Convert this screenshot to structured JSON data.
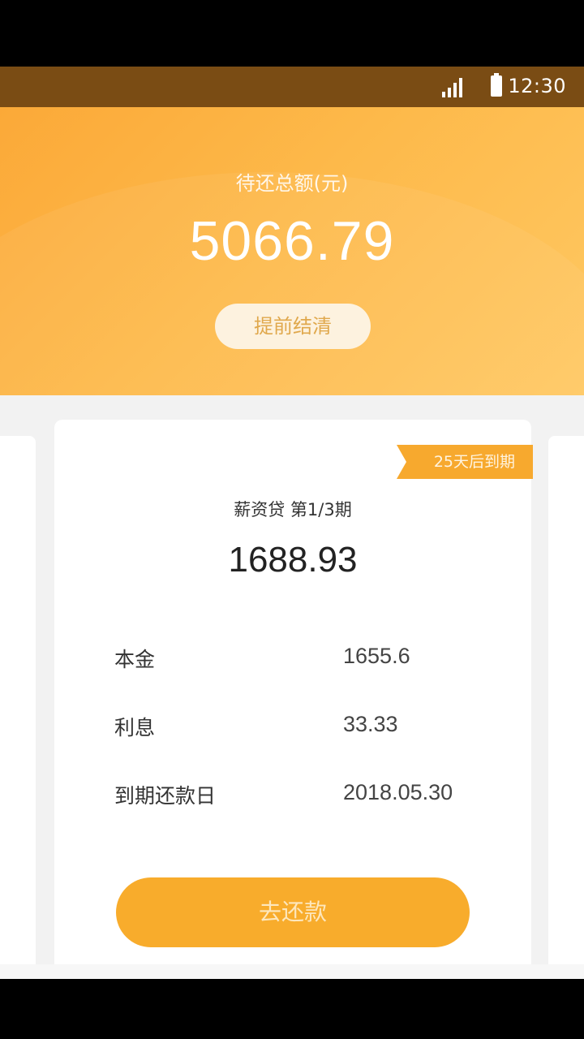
{
  "status_bar": {
    "time": "12:30"
  },
  "header": {
    "total_label": "待还总额(元)",
    "total_amount": "5066.79",
    "settle_button": "提前结清"
  },
  "card": {
    "due_tag": "25天后到期",
    "loan_title": "薪资贷 第1/3期",
    "amount": "1688.93",
    "details": [
      {
        "label": "本金",
        "value": "1655.6"
      },
      {
        "label": "利息",
        "value": "33.33"
      },
      {
        "label": "到期还款日",
        "value": "2018.05.30"
      }
    ],
    "pay_button": "去还款"
  },
  "colors": {
    "accent": "#f8ac2c",
    "status_bar": "#7a4c14"
  },
  "icons": [
    "signal-icon",
    "battery-icon"
  ]
}
